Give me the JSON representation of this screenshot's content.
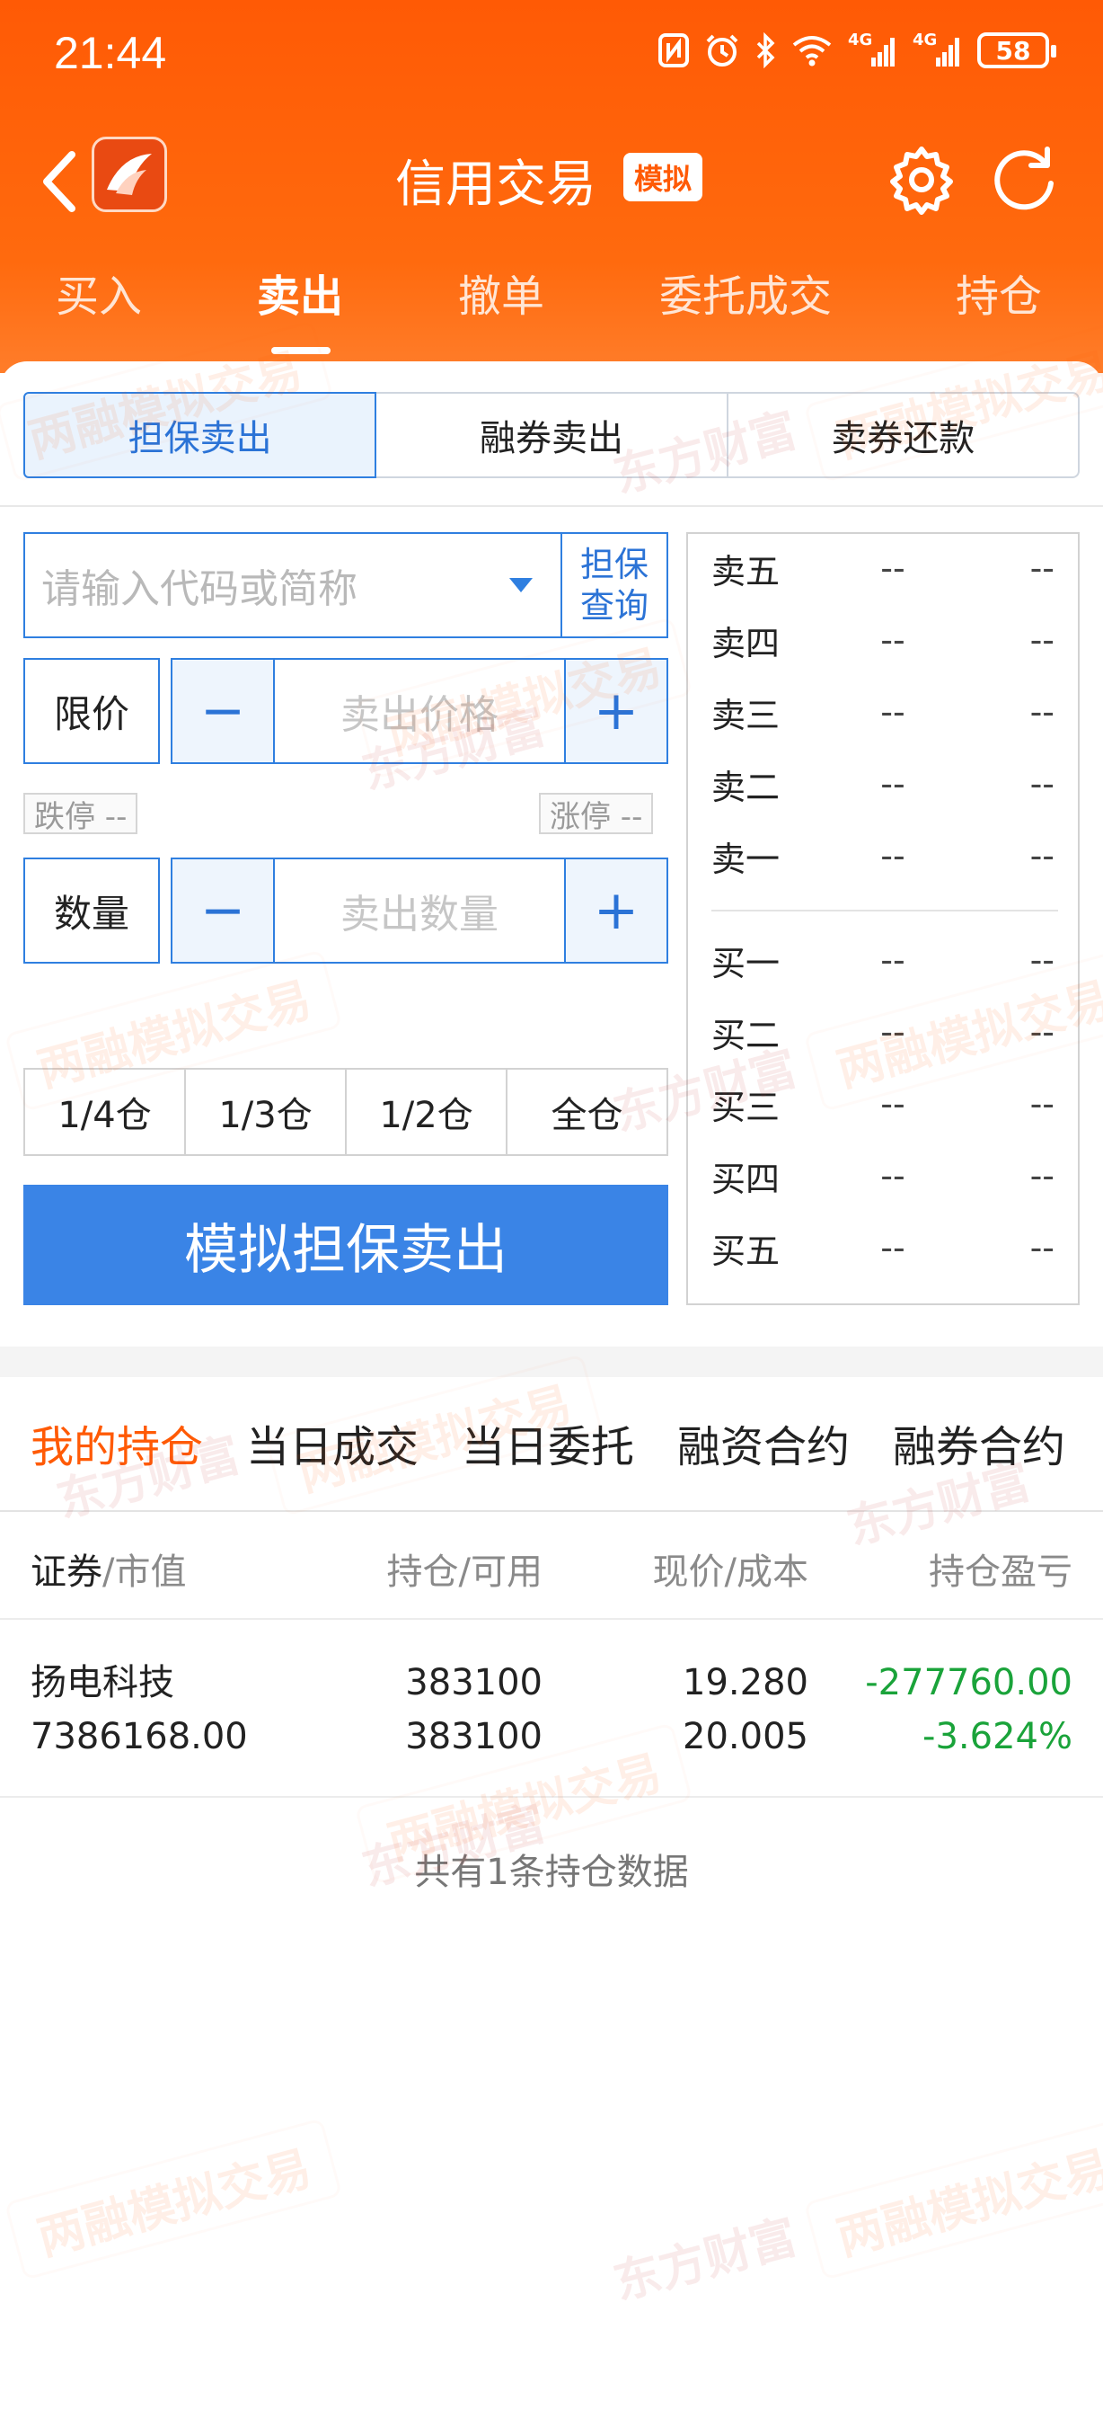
{
  "status": {
    "time": "21:44",
    "net_1": "4G",
    "net_2": "4G",
    "battery": "58"
  },
  "header": {
    "title": "信用交易",
    "badge": "模拟",
    "tabs": [
      "买入",
      "卖出",
      "撤单",
      "委托成交",
      "持仓"
    ],
    "active_tab": "卖出"
  },
  "segments": [
    "担保卖出",
    "融券卖出",
    "卖券还款"
  ],
  "form": {
    "code_placeholder": "请输入代码或简称",
    "query_line1": "担保",
    "query_line2": "查询",
    "price_type": "限价",
    "price_placeholder": "卖出价格",
    "limit_down": "跌停 --",
    "limit_up": "涨停 --",
    "qty_label": "数量",
    "qty_placeholder": "卖出数量",
    "position_buttons": [
      "1/4仓",
      "1/3仓",
      "1/2仓",
      "全仓"
    ],
    "submit_label": "模拟担保卖出"
  },
  "order_book": {
    "sell": [
      {
        "label": "卖五",
        "price": "--",
        "vol": "--"
      },
      {
        "label": "卖四",
        "price": "--",
        "vol": "--"
      },
      {
        "label": "卖三",
        "price": "--",
        "vol": "--"
      },
      {
        "label": "卖二",
        "price": "--",
        "vol": "--"
      },
      {
        "label": "卖一",
        "price": "--",
        "vol": "--"
      }
    ],
    "buy": [
      {
        "label": "买一",
        "price": "--",
        "vol": "--"
      },
      {
        "label": "买二",
        "price": "--",
        "vol": "--"
      },
      {
        "label": "买三",
        "price": "--",
        "vol": "--"
      },
      {
        "label": "买四",
        "price": "--",
        "vol": "--"
      },
      {
        "label": "买五",
        "price": "--",
        "vol": "--"
      }
    ]
  },
  "positions": {
    "tabs": [
      "我的持仓",
      "当日成交",
      "当日委托",
      "融资合约",
      "融券合约"
    ],
    "active_tab": "我的持仓",
    "headers": {
      "security": "证券",
      "market_value": "/市值",
      "holding": "持仓/可用",
      "price": "现价/成本",
      "pnl": "持仓盈亏"
    },
    "rows": [
      {
        "name": "扬电科技",
        "market_value": "7386168.00",
        "holding": "383100",
        "available": "383100",
        "price": "19.280",
        "cost": "20.005",
        "pnl": "-277760.00",
        "pnl_pct": "-3.624%"
      }
    ],
    "footer": "共有1条持仓数据"
  },
  "watermark": {
    "text_a": "两融模拟交易",
    "text_b": "东方财富"
  },
  "colors": {
    "brand_orange": "#ff5a05",
    "accent_blue": "#2f7fe0",
    "loss_green": "#1aa33a"
  }
}
